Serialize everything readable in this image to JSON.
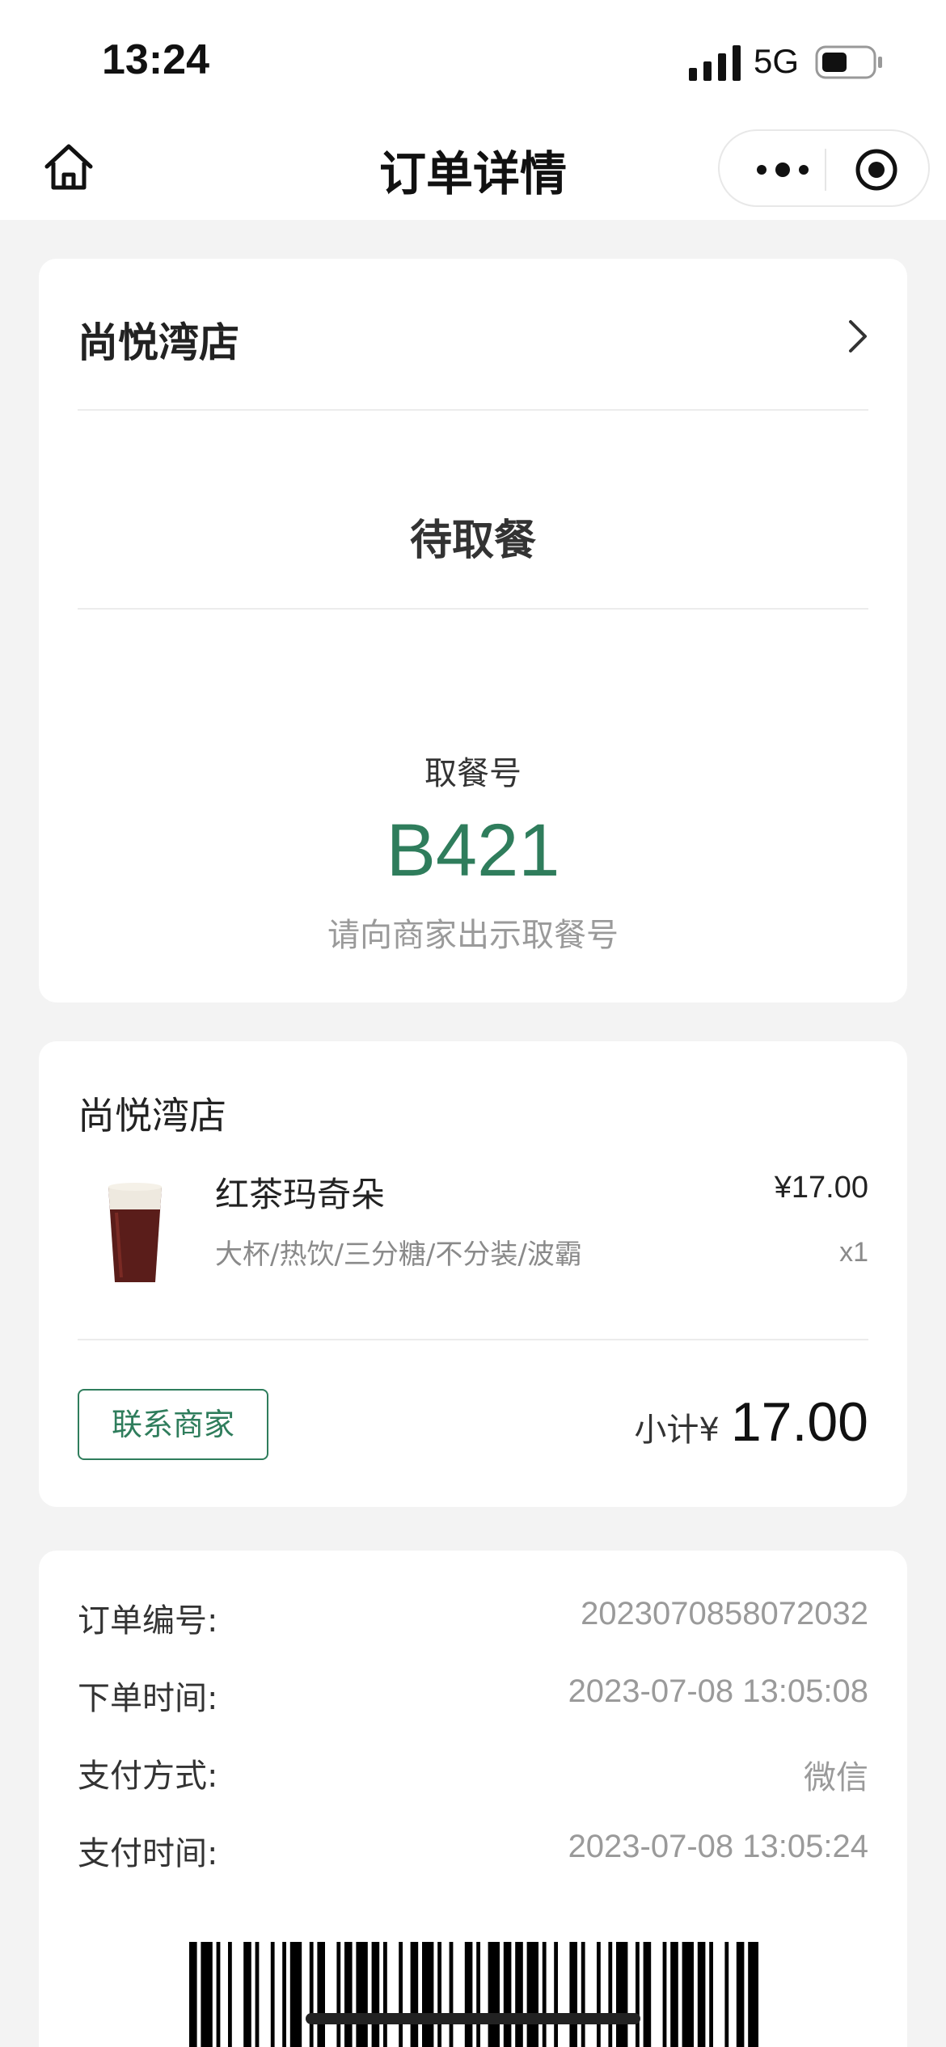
{
  "status_bar": {
    "time": "13:24",
    "network": "5G"
  },
  "nav": {
    "title": "订单详情"
  },
  "order_status": {
    "store_name": "尚悦湾店",
    "status": "待取餐",
    "pickup_label": "取餐号",
    "pickup_number": "B421",
    "pickup_hint": "请向商家出示取餐号"
  },
  "order_items": {
    "store_name": "尚悦湾店",
    "items": [
      {
        "name": "红茶玛奇朵",
        "price": "¥17.00",
        "spec": "大杯/热饮/三分糖/不分装/波霸",
        "qty": "x1"
      }
    ],
    "contact_label": "联系商家",
    "subtotal_label": "小计¥",
    "subtotal_value": "17.00"
  },
  "order_info": {
    "rows": [
      {
        "label": "订单编号:",
        "value": "2023070858072032"
      },
      {
        "label": "下单时间:",
        "value": "2023-07-08 13:05:08"
      },
      {
        "label": "支付方式:",
        "value": "微信"
      },
      {
        "label": "支付时间:",
        "value": "2023-07-08 13:05:24"
      }
    ]
  },
  "colors": {
    "accent": "#2f7d5c",
    "background": "#f3f3f3",
    "muted": "#9a9a9a"
  },
  "icons": [
    "home-icon",
    "more-icon",
    "close-capsule-icon",
    "chevron-right-icon",
    "barcode"
  ]
}
